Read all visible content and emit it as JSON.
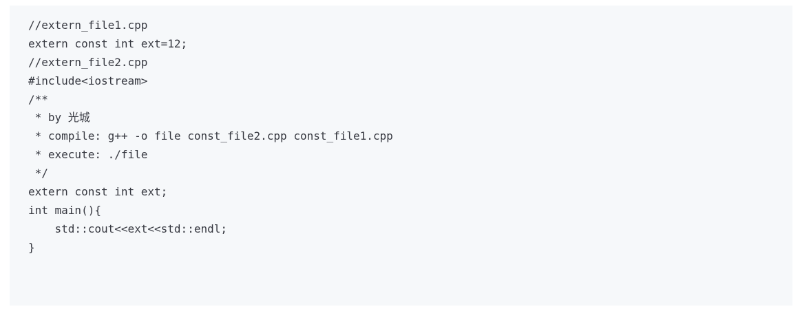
{
  "code": {
    "lines": [
      "//extern_file1.cpp",
      "extern const int ext=12;",
      "//extern_file2.cpp",
      "#include<iostream>",
      "/**",
      " * by 光城",
      " * compile: g++ -o file const_file2.cpp const_file1.cpp",
      " * execute: ./file",
      " */",
      "extern const int ext;",
      "int main(){",
      "    std::cout<<ext<<std::endl;",
      "}"
    ]
  }
}
